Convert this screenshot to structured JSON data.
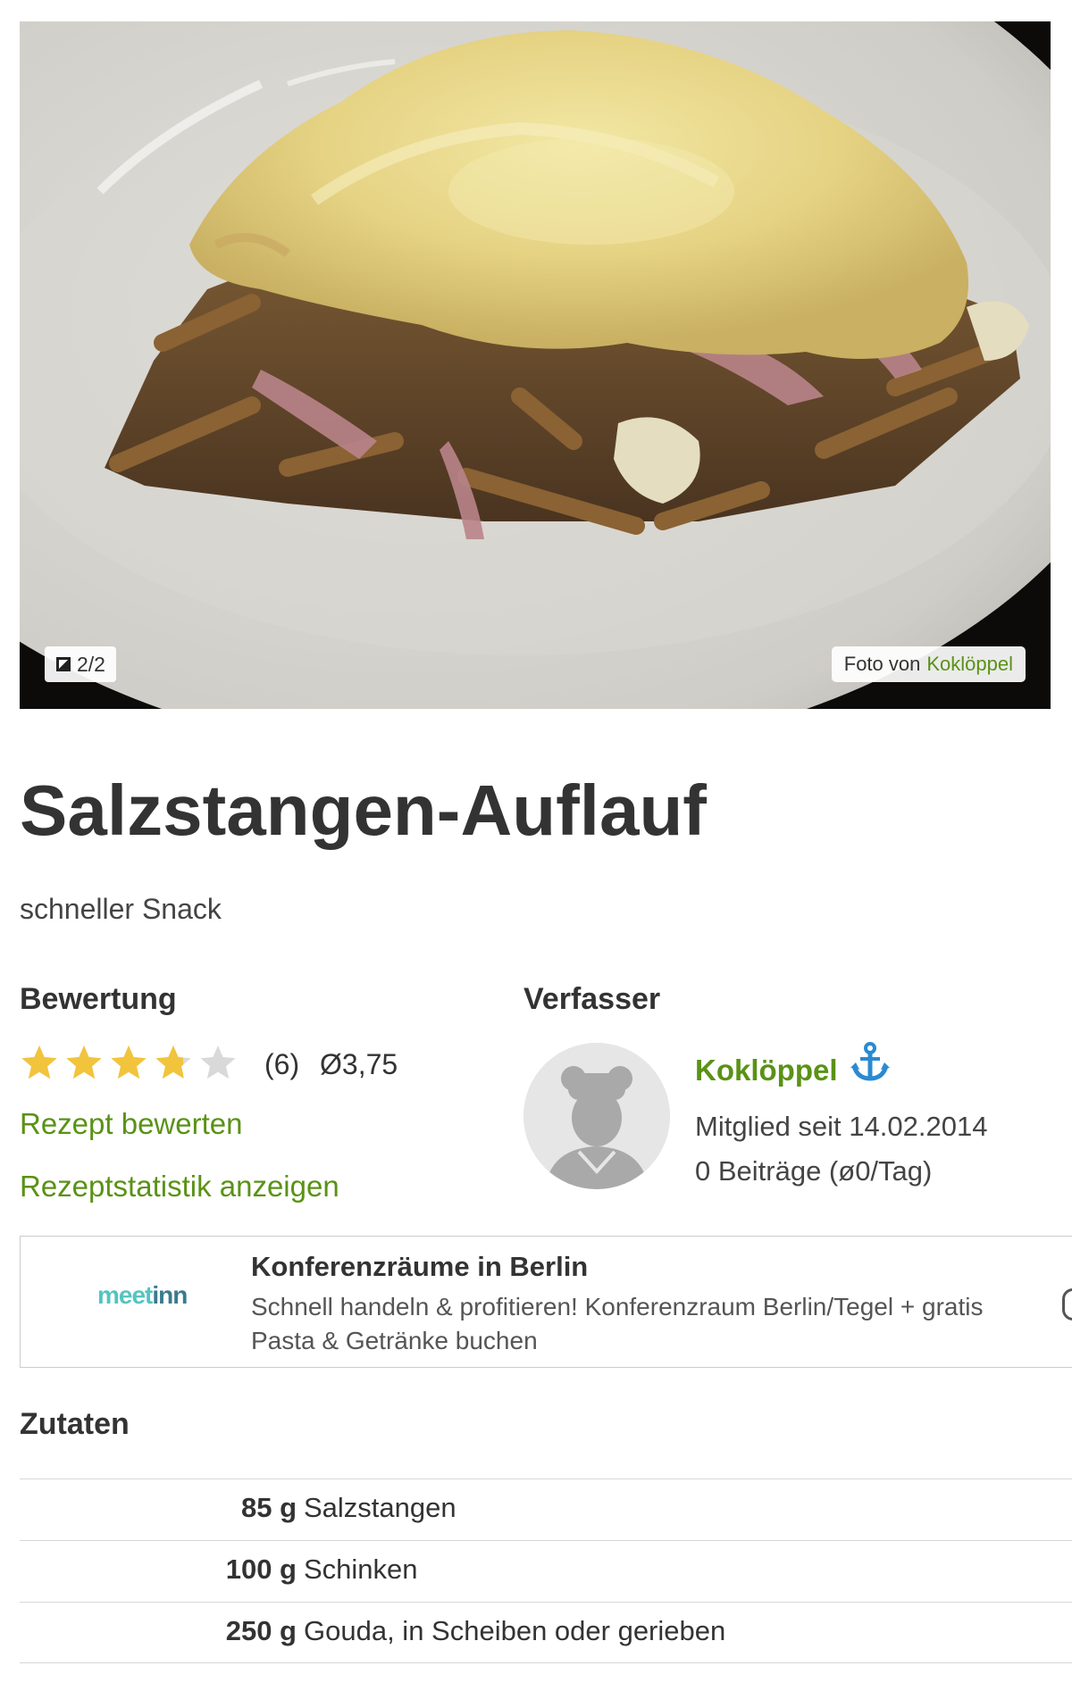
{
  "photo": {
    "counter": "2/2",
    "credit_prefix": "Foto von",
    "credit_author": "Koklöppel"
  },
  "recipe": {
    "title": "Salzstangen-Auflauf",
    "subtitle": "schneller Snack"
  },
  "rating": {
    "heading": "Bewertung",
    "stars": 3.75,
    "max_stars": 5,
    "count": "(6)",
    "average": "Ø3,75",
    "rate_link": "Rezept bewerten",
    "stats_link": "Rezeptstatistik anzeigen"
  },
  "author": {
    "heading": "Verfasser",
    "name": "Koklöppel",
    "icon": "anchor-icon",
    "member_since": "Mitglied seit 14.02.2014",
    "posts": "0 Beiträge (ø0/Tag)"
  },
  "ad": {
    "logo_a": "meet",
    "logo_b": "inn",
    "title": "Konferenzräume in Berlin",
    "text": "Schnell handeln & profitieren! Konferenzraum Berlin/Tegel + gratis Pasta & Getränke buchen"
  },
  "ingredients": {
    "heading": "Zutaten",
    "items": [
      {
        "amount": "85 g",
        "name": "Salzstangen"
      },
      {
        "amount": "100 g",
        "name": "Schinken"
      },
      {
        "amount": "250 g",
        "name": "Gouda, in Scheiben oder gerieben"
      }
    ]
  },
  "colors": {
    "link_green": "#5a9216",
    "star_gold": "#f2c43c",
    "star_empty": "#d9d9d9",
    "anchor_blue": "#2a8ad1"
  }
}
